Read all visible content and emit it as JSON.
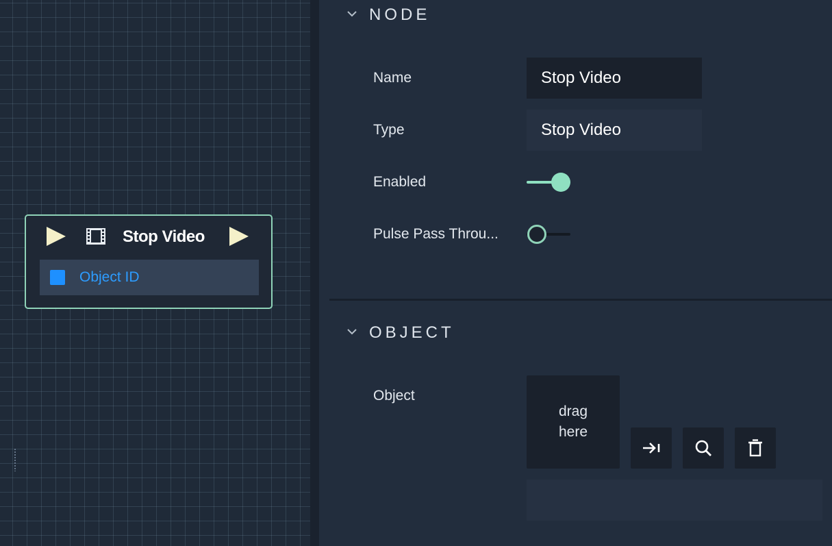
{
  "graph": {
    "node": {
      "title": "Stop Video",
      "input_port_label": "Object ID",
      "accent_color": "#8fd3b8",
      "port_color": "#1e90ff"
    }
  },
  "inspector": {
    "node_section": {
      "title": "NODE",
      "name_label": "Name",
      "name_value": "Stop Video",
      "type_label": "Type",
      "type_value": "Stop Video",
      "enabled_label": "Enabled",
      "enabled_on": true,
      "pulse_label": "Pulse Pass Throu...",
      "pulse_on": false
    },
    "object_section": {
      "title": "OBJECT",
      "object_label": "Object",
      "drop_line1": "drag",
      "drop_line2": "here",
      "path_value": ""
    }
  },
  "icons": {
    "collapse": "chevron-down-icon",
    "node_type": "film-icon",
    "flow_in": "play-icon",
    "flow_out": "play-icon",
    "goto": "arrow-to-bar-icon",
    "search": "search-icon",
    "delete": "trash-icon"
  },
  "colors": {
    "toggle_accent": "#8fe0c1",
    "background": "#222d3d"
  }
}
